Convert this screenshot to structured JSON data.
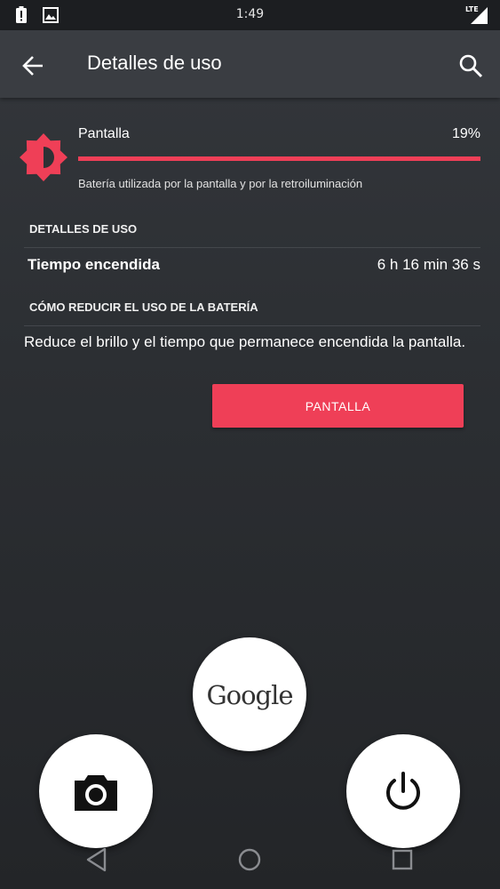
{
  "status_bar": {
    "time": "1:49",
    "network": "LTE",
    "icons": [
      "alert-icon",
      "image-icon",
      "signal-icon"
    ]
  },
  "app_bar": {
    "title": "Detalles de uso",
    "icons": [
      "arrow-back-icon",
      "search-icon"
    ]
  },
  "usage_item": {
    "label": "Pantalla",
    "percent_label": "19%",
    "percent_value": 19,
    "description": "Batería utilizada por la pantalla y por la retroiluminación",
    "icon": "brightness-icon"
  },
  "details": {
    "header": "DETALLES DE USO",
    "rows": [
      {
        "label": "Tiempo encendida",
        "value": "6 h 16 min 36 s"
      }
    ]
  },
  "reduce": {
    "header": "CÓMO REDUCIR EL USO DE LA BATERÍA",
    "tip": "Reduce el brillo y el tiempo que permanece encendida la pantalla.",
    "button_label": "PANTALLA"
  },
  "floating": {
    "google_label": "Google",
    "icons": [
      "camera-icon",
      "power-icon"
    ]
  },
  "nav_bar": {
    "icons": [
      "nav-back-icon",
      "nav-home-icon",
      "nav-recent-icon"
    ]
  },
  "colors": {
    "accent": "#ef3f57",
    "app_bar": "#3a3d42",
    "status_bar": "#1c1e21",
    "background": "#2c2f33"
  }
}
